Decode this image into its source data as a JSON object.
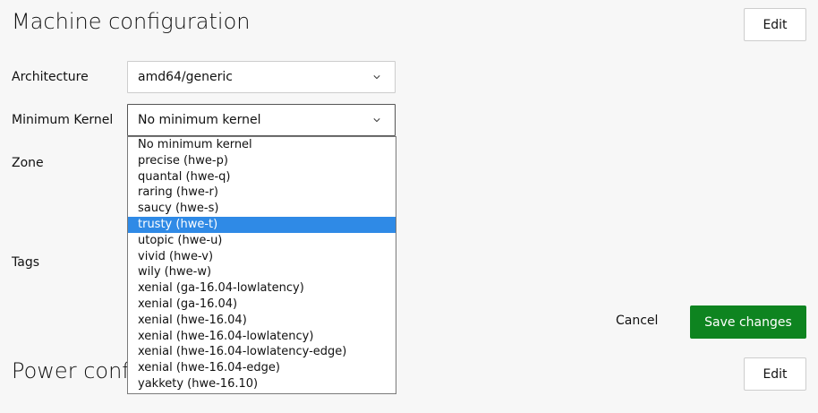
{
  "machine_config": {
    "title": "Machine configuration",
    "edit_label": "Edit",
    "architecture": {
      "label": "Architecture",
      "value": "amd64/generic"
    },
    "min_kernel": {
      "label": "Minimum Kernel",
      "value": "No minimum kernel",
      "options": [
        "No minimum kernel",
        "precise (hwe-p)",
        "quantal (hwe-q)",
        "raring (hwe-r)",
        "saucy (hwe-s)",
        "trusty (hwe-t)",
        "utopic (hwe-u)",
        "vivid (hwe-v)",
        "wily (hwe-w)",
        "xenial (ga-16.04-lowlatency)",
        "xenial (ga-16.04)",
        "xenial (hwe-16.04)",
        "xenial (hwe-16.04-lowlatency)",
        "xenial (hwe-16.04-lowlatency-edge)",
        "xenial (hwe-16.04-edge)",
        "yakkety (hwe-16.10)"
      ],
      "highlighted_option": "trusty (hwe-t)"
    },
    "zone": {
      "label": "Zone"
    },
    "tags": {
      "label": "Tags"
    },
    "cancel_label": "Cancel",
    "save_label": "Save changes"
  },
  "power_config": {
    "title": "Power conf",
    "edit_label": "Edit"
  },
  "colors": {
    "save_button": "#0e8420",
    "highlight": "#2f8ae6",
    "background": "#f7f7f7"
  }
}
